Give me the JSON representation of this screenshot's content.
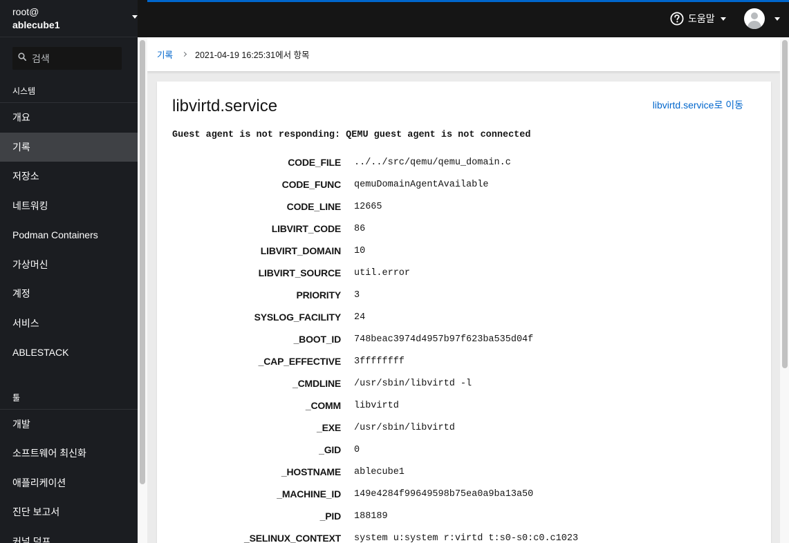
{
  "host": {
    "user": "root@",
    "name": "ablecube1"
  },
  "search": {
    "placeholder": "검색",
    "value": ""
  },
  "sidebar": {
    "sections": [
      {
        "title": "시스템",
        "items": [
          {
            "label": "개요",
            "active": false
          },
          {
            "label": "기록",
            "active": true
          },
          {
            "label": "저장소",
            "active": false
          },
          {
            "label": "네트워킹",
            "active": false
          },
          {
            "label": "Podman Containers",
            "active": false
          },
          {
            "label": "가상머신",
            "active": false
          },
          {
            "label": "계정",
            "active": false
          },
          {
            "label": "서비스",
            "active": false
          },
          {
            "label": "ABLESTACK",
            "active": false
          }
        ]
      },
      {
        "title": "툴",
        "items": [
          {
            "label": "개발",
            "active": false
          },
          {
            "label": "소프트웨어 최신화",
            "active": false
          },
          {
            "label": "애플리케이션",
            "active": false
          },
          {
            "label": "진단 보고서",
            "active": false
          },
          {
            "label": "커널 덤프",
            "active": false
          }
        ]
      }
    ]
  },
  "topbar": {
    "help_label": "도움말",
    "accent_color": "#0066cc"
  },
  "breadcrumb": {
    "parent": "기록",
    "current": "2021-04-19 16:25:31에서 항목"
  },
  "entry": {
    "title": "libvirtd.service",
    "goto_link": "libvirtd.service로 이동",
    "message": "Guest agent is not responding: QEMU guest agent is not connected",
    "fields": [
      {
        "key": "CODE_FILE",
        "value": "../../src/qemu/qemu_domain.c"
      },
      {
        "key": "CODE_FUNC",
        "value": "qemuDomainAgentAvailable"
      },
      {
        "key": "CODE_LINE",
        "value": "12665"
      },
      {
        "key": "LIBVIRT_CODE",
        "value": "86"
      },
      {
        "key": "LIBVIRT_DOMAIN",
        "value": "10"
      },
      {
        "key": "LIBVIRT_SOURCE",
        "value": "util.error"
      },
      {
        "key": "PRIORITY",
        "value": "3"
      },
      {
        "key": "SYSLOG_FACILITY",
        "value": "24"
      },
      {
        "key": "_BOOT_ID",
        "value": "748beac3974d4957b97f623ba535d04f"
      },
      {
        "key": "_CAP_EFFECTIVE",
        "value": "3ffffffff"
      },
      {
        "key": "_CMDLINE",
        "value": "/usr/sbin/libvirtd -l"
      },
      {
        "key": "_COMM",
        "value": "libvirtd"
      },
      {
        "key": "_EXE",
        "value": "/usr/sbin/libvirtd"
      },
      {
        "key": "_GID",
        "value": "0"
      },
      {
        "key": "_HOSTNAME",
        "value": "ablecube1"
      },
      {
        "key": "_MACHINE_ID",
        "value": "149e4284f99649598b75ea0a9ba13a50"
      },
      {
        "key": "_PID",
        "value": "188189"
      },
      {
        "key": "_SELINUX_CONTEXT",
        "value": "system u:system r:virtd t:s0-s0:c0.c1023"
      }
    ]
  }
}
